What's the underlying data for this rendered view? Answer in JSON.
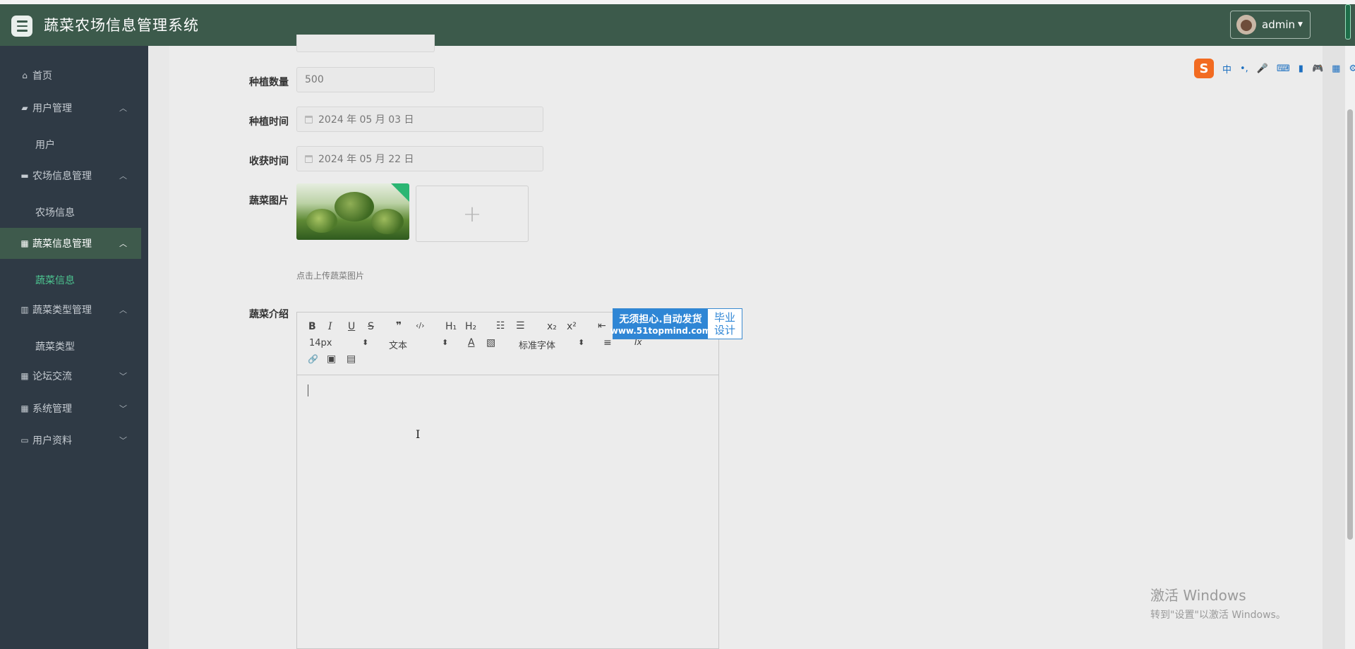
{
  "header": {
    "title": "蔬菜农场信息管理系统",
    "user": "admin"
  },
  "sidebar": {
    "items": [
      {
        "label": "首页"
      },
      {
        "label": "用户管理"
      },
      {
        "label": "用户"
      },
      {
        "label": "农场信息管理"
      },
      {
        "label": "农场信息"
      },
      {
        "label": "蔬菜信息管理"
      },
      {
        "label": "蔬菜信息"
      },
      {
        "label": "蔬菜类型管理"
      },
      {
        "label": "蔬菜类型"
      },
      {
        "label": "论坛交流"
      },
      {
        "label": "系统管理"
      },
      {
        "label": "用户资料"
      }
    ]
  },
  "form": {
    "planting_quantity_label": "种植数量",
    "planting_quantity_value": "500",
    "planting_time_label": "种植时间",
    "planting_time_value": "2024 年 05 月 03 日",
    "harvest_time_label": "收获时间",
    "harvest_time_value": "2024 年 05 月 22 日",
    "image_label": "蔬菜图片",
    "upload_plus": "+",
    "upload_hint": "点击上传蔬菜图片",
    "intro_label": "蔬菜介绍"
  },
  "editor": {
    "bold": "B",
    "italic": "I",
    "underline": "U",
    "strike": "S",
    "quote": "❞",
    "code": "‹/›",
    "h1": "H₁",
    "h2": "H₂",
    "ordered_list": "☷",
    "bullet_list": "☰",
    "subscript": "x₂",
    "superscript": "x²",
    "outdent": "⇤",
    "font_size": "14px",
    "text_style": "文本",
    "font_color": "A",
    "bg_color": "▧",
    "font_family": "标准字体",
    "align": "≡",
    "clear_format": "Ix",
    "link": "🔗",
    "image": "▣",
    "video": "▤",
    "select_arrow": "⬍"
  },
  "ad": {
    "line1": "无须担心.自动发货",
    "line2": "www.51topmind.com",
    "side1": "毕业",
    "side2": "设计"
  },
  "ime": {
    "logo": "S",
    "items": [
      "中",
      "•,",
      "🎤",
      "⌨",
      "▮",
      "🎮",
      "▦",
      "⚙"
    ]
  },
  "watermark": {
    "line1": "激活 Windows",
    "line2": "转到\"设置\"以激活 Windows。"
  }
}
